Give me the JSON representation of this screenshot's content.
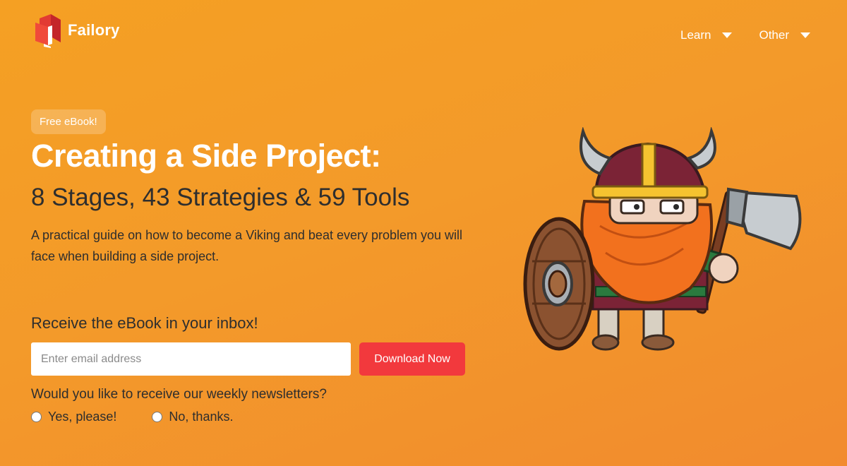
{
  "header": {
    "brand": "Failory",
    "nav": [
      {
        "label": "Learn"
      },
      {
        "label": "Other"
      }
    ]
  },
  "hero": {
    "badge": "Free eBook!",
    "title": "Creating a Side Project:",
    "subtitle": "8 Stages, 43 Strategies & 59 Tools",
    "description": "A practical guide on how to become a Viking and beat every problem you will face when building a side project."
  },
  "signup": {
    "prompt": "Receive the eBook in your inbox!",
    "email_placeholder": "Enter email address",
    "email_value": "",
    "button_label": "Download Now",
    "newsletter_question": "Would you like to receive our weekly newsletters?",
    "options": [
      {
        "label": "Yes, please!",
        "selected": false
      },
      {
        "label": "No, thanks.",
        "selected": false
      }
    ]
  },
  "colors": {
    "background": "#f5a023",
    "button": "#f2393d",
    "text_dark": "#2e2e2e"
  }
}
